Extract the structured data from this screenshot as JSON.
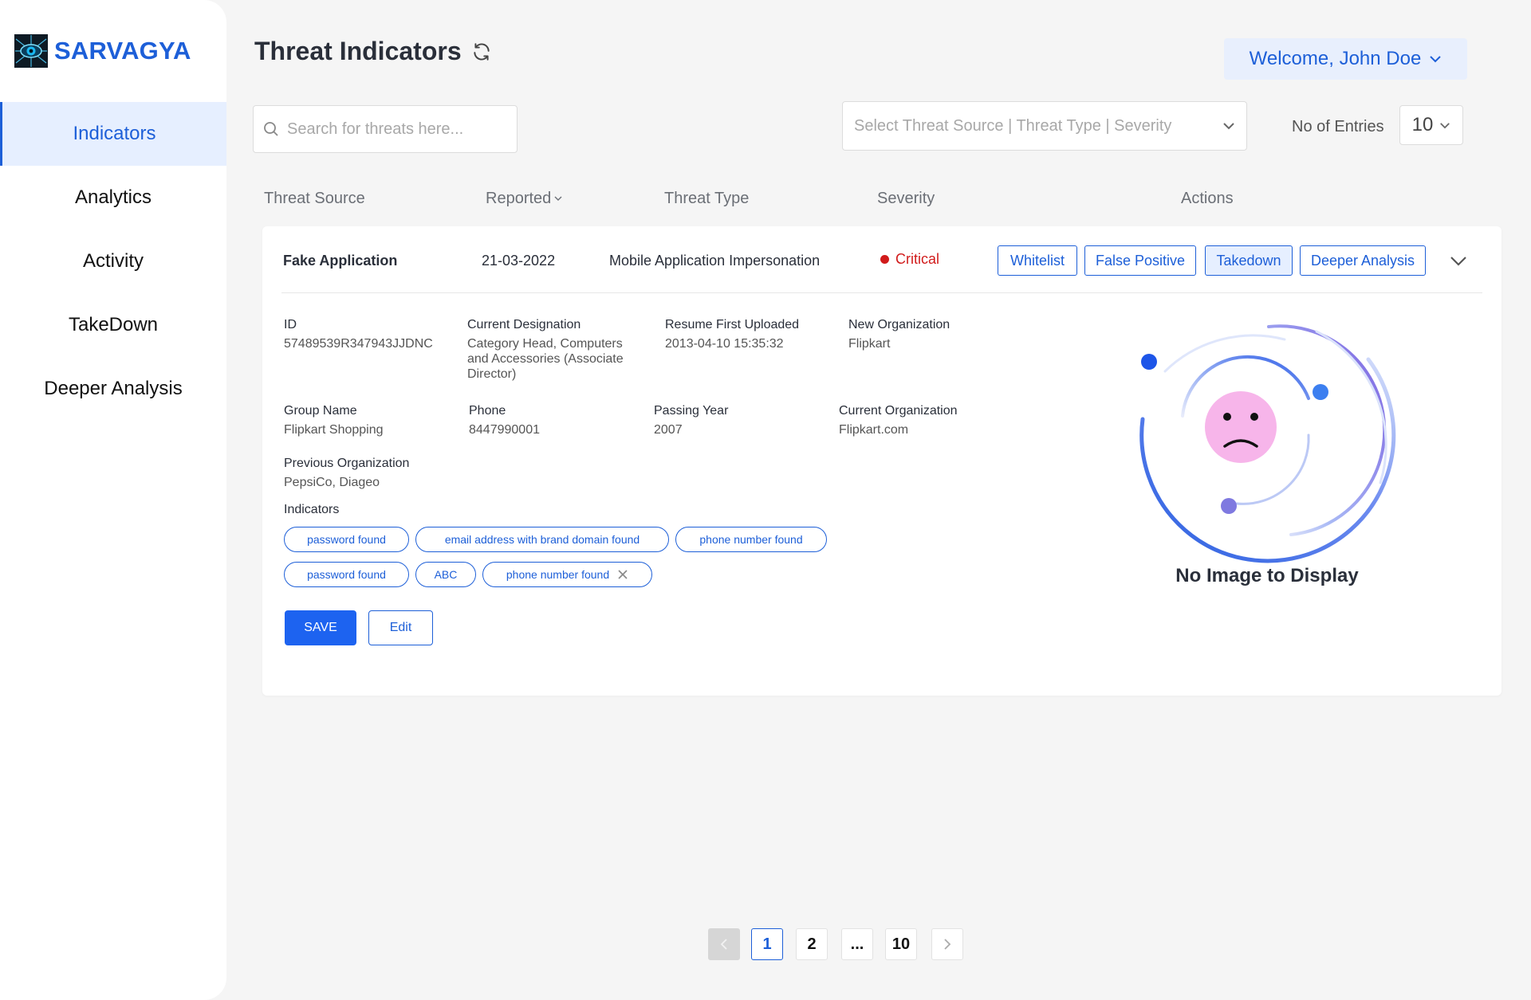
{
  "brand": {
    "name": "SARVAGYA"
  },
  "sidebar": {
    "items": [
      {
        "label": "Indicators",
        "active": true
      },
      {
        "label": "Analytics"
      },
      {
        "label": "Activity"
      },
      {
        "label": "TakeDown"
      },
      {
        "label": "Deeper Analysis"
      }
    ]
  },
  "header": {
    "title": "Threat Indicators",
    "welcome": "Welcome, John Doe"
  },
  "toolbar": {
    "search_placeholder": "Search for threats here...",
    "filter_placeholder": "Select Threat Source |  Threat Type | Severity",
    "entries_label": "No of Entries",
    "entries_value": "10"
  },
  "table": {
    "columns": {
      "source": "Threat Source",
      "reported": "Reported",
      "type": "Threat Type",
      "severity": "Severity",
      "actions": "Actions"
    },
    "row": {
      "source": "Fake Application",
      "reported": "21-03-2022",
      "type": "Mobile Application Impersonation",
      "severity": "Critical",
      "actions": {
        "whitelist": "Whitelist",
        "false_positive": "False Positive",
        "takedown": "Takedown",
        "deeper_analysis": "Deeper Analysis"
      }
    }
  },
  "details": {
    "id": {
      "label": "ID",
      "value": "57489539R347943JJDNC"
    },
    "designation": {
      "label": "Current Designation",
      "line1": "Category Head, Computers",
      "line2": "and Accessories (Associate",
      "line3": "Director)"
    },
    "resume": {
      "label": "Resume First Uploaded",
      "value": "2013-04-10 15:35:32"
    },
    "new_org": {
      "label": "New Organization",
      "value": "Flipkart"
    },
    "group": {
      "label": "Group Name",
      "value": "Flipkart Shopping"
    },
    "phone": {
      "label": "Phone",
      "value": "8447990001"
    },
    "passing_year": {
      "label": "Passing Year",
      "value": "2007"
    },
    "current_org": {
      "label": "Current Organization",
      "value": "Flipkart.com"
    },
    "prev_org": {
      "label": "Previous Organization",
      "value": "PepsiCo, Diageo"
    },
    "indicators_label": "Indicators",
    "indicators": [
      "password found",
      "email address with brand domain found",
      "phone number found",
      "password found",
      "ABC",
      "phone number found"
    ],
    "save_label": "SAVE",
    "edit_label": "Edit",
    "no_image_text": "No Image to Display"
  },
  "pagination": {
    "pages": [
      "1",
      "2",
      "...",
      "10"
    ],
    "current": "1"
  },
  "colors": {
    "accent": "#1d5fd8",
    "critical": "#d11b1b",
    "save": "#1d63f0"
  }
}
